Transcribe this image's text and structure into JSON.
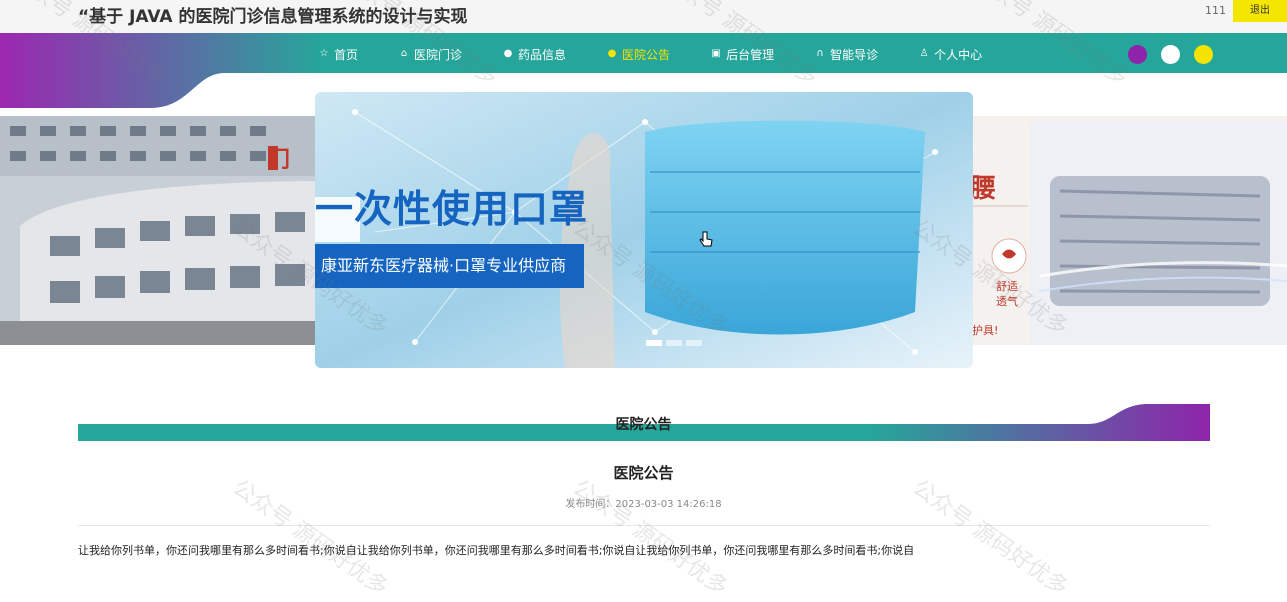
{
  "header": {
    "site_title": "“基于 JAVA 的医院门诊信息管理系统的设计与实现",
    "username": "111",
    "logout_label": "退出"
  },
  "nav": {
    "items": [
      {
        "label": "首页",
        "icon": "star-icon"
      },
      {
        "label": "医院门诊",
        "icon": "home-icon"
      },
      {
        "label": "药品信息",
        "icon": "pill-icon"
      },
      {
        "label": "医院公告",
        "icon": "announcement-icon",
        "active": true
      },
      {
        "label": "后台管理",
        "icon": "admin-icon"
      },
      {
        "label": "智能导诊",
        "icon": "headset-icon"
      },
      {
        "label": "个人中心",
        "icon": "user-icon"
      }
    ],
    "theme_dots": [
      "#8e24aa",
      "#ffffff",
      "#f4e300"
    ]
  },
  "carousel": {
    "heading": "一次性使用口罩",
    "subtitle": "康亚新东医疗器械·口罩专业供应商",
    "right_slide_text": "腰",
    "right_slide_small": [
      "舒适",
      "透气",
      "护具!"
    ],
    "left_slide_text": "门"
  },
  "section": {
    "title": "医院公告"
  },
  "article": {
    "title": "医院公告",
    "date_label": "发布时间：2023-03-03 14:26:18",
    "body": "让我给你列书单，你还问我哪里有那么多时间看书;你说自让我给你列书单，你还问我哪里有那么多时间看书;你说自让我给你列书单，你还问我哪里有那么多时间看书;你说自"
  },
  "watermark": "公众号 源码好优多",
  "colors": {
    "teal": "#26a69a",
    "purple": "#8e24aa",
    "active_yellow": "#f4e300"
  }
}
